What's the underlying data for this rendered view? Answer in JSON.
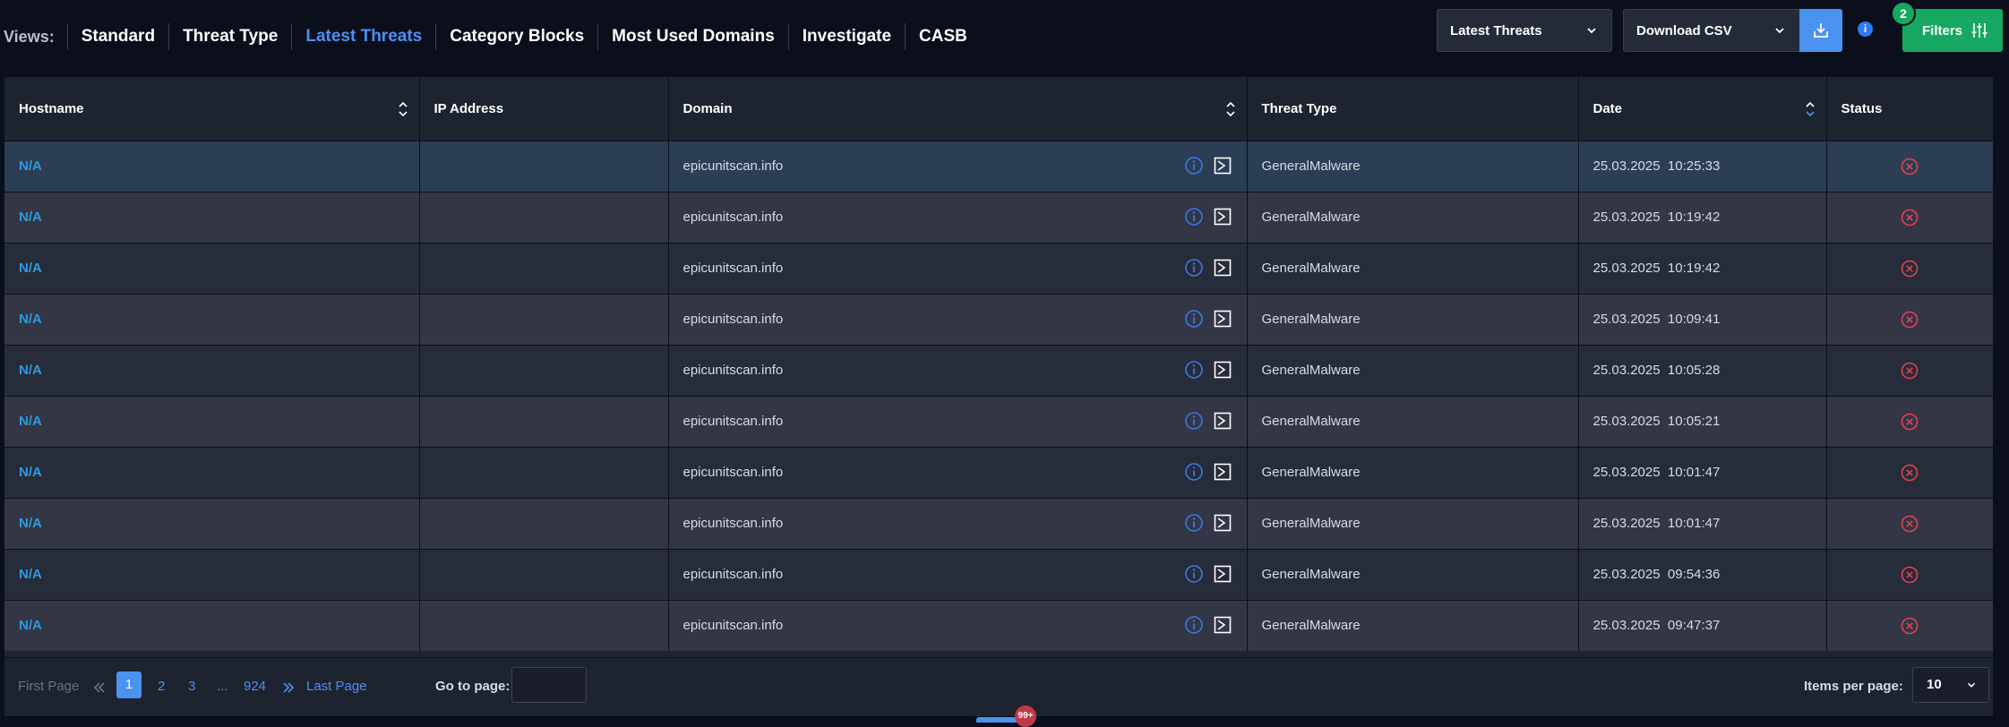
{
  "views": {
    "label": "Views:",
    "tabs": [
      {
        "label": "Standard",
        "active": false
      },
      {
        "label": "Threat Type",
        "active": false
      },
      {
        "label": "Latest Threats",
        "active": true
      },
      {
        "label": "Category Blocks",
        "active": false
      },
      {
        "label": "Most Used Domains",
        "active": false
      },
      {
        "label": "Investigate",
        "active": false
      },
      {
        "label": "CASB",
        "active": false
      }
    ]
  },
  "toolbar": {
    "view_select": "Latest Threats",
    "download_select": "Download CSV",
    "info_icon": "i",
    "filters_label": "Filters",
    "filters_count": "2"
  },
  "table": {
    "columns": [
      "Hostname",
      "IP Address",
      "Domain",
      "Threat Type",
      "Date",
      "Status"
    ],
    "rows": [
      {
        "hostname": "N/A",
        "ip": " ",
        "domain": "epicunitscan.info",
        "threat": "GeneralMalware",
        "date": "25.03.2025  10:25:33"
      },
      {
        "hostname": "N/A",
        "ip": " ",
        "domain": "epicunitscan.info",
        "threat": "GeneralMalware",
        "date": "25.03.2025  10:19:42"
      },
      {
        "hostname": "N/A",
        "ip": " ",
        "domain": "epicunitscan.info",
        "threat": "GeneralMalware",
        "date": "25.03.2025  10:19:42"
      },
      {
        "hostname": "N/A",
        "ip": " ",
        "domain": "epicunitscan.info",
        "threat": "GeneralMalware",
        "date": "25.03.2025  10:09:41"
      },
      {
        "hostname": "N/A",
        "ip": " ",
        "domain": "epicunitscan.info",
        "threat": "GeneralMalware",
        "date": "25.03.2025  10:05:28"
      },
      {
        "hostname": "N/A",
        "ip": " ",
        "domain": "epicunitscan.info",
        "threat": "GeneralMalware",
        "date": "25.03.2025  10:05:21"
      },
      {
        "hostname": "N/A",
        "ip": " ",
        "domain": "epicunitscan.info",
        "threat": "GeneralMalware",
        "date": "25.03.2025  10:01:47"
      },
      {
        "hostname": "N/A",
        "ip": " ",
        "domain": "epicunitscan.info",
        "threat": "GeneralMalware",
        "date": "25.03.2025  10:01:47"
      },
      {
        "hostname": "N/A",
        "ip": " ",
        "domain": "epicunitscan.info",
        "threat": "GeneralMalware",
        "date": "25.03.2025  09:54:36"
      },
      {
        "hostname": "N/A",
        "ip": " ",
        "domain": "epicunitscan.info",
        "threat": "GeneralMalware",
        "date": "25.03.2025  09:47:37"
      }
    ]
  },
  "pagination": {
    "first_label": "First Page",
    "last_label": "Last Page",
    "pages": [
      "1",
      "2",
      "3",
      "...",
      "924"
    ],
    "current_page": "1",
    "goto_label": "Go to page:",
    "goto_value": "",
    "items_label": "Items per page:",
    "items_value": "10"
  },
  "bottom": {
    "notification_badge": "99+"
  },
  "colors": {
    "accent": "#4a93f0",
    "success": "#16a860",
    "danger": "#e2434e",
    "link": "#2f9ae0"
  }
}
